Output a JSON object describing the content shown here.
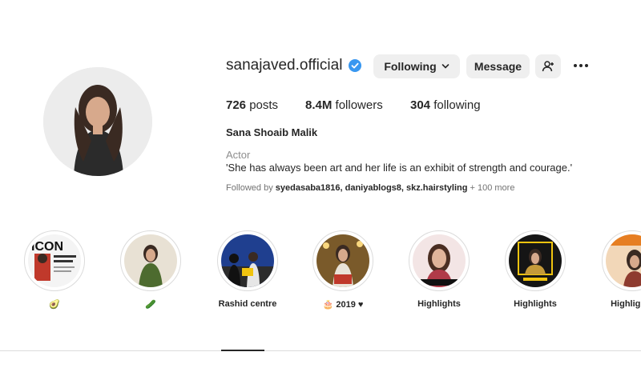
{
  "profile": {
    "username": "sanajaved.official",
    "full_name": "Sana Shoaib Malik",
    "category": "Actor",
    "bio": "'She has always been art and her life is an exhibit of strength and courage.'",
    "followed_by_prefix": "Followed by ",
    "followed_by_names": "syedasaba1816, daniyablogs8, skz.hairstyling",
    "followed_by_more": " + 100 more"
  },
  "buttons": {
    "following": "Following",
    "message": "Message"
  },
  "stats": {
    "posts_count": "726",
    "posts_label": " posts",
    "followers_count": "8.4M",
    "followers_label": " followers",
    "following_count": "304",
    "following_label": " following"
  },
  "highlights": [
    {
      "label": "🥑"
    },
    {
      "label": "🥒"
    },
    {
      "label": "Rashid centre"
    },
    {
      "label": "🎂 2019 ♥"
    },
    {
      "label": "Highlights"
    },
    {
      "label": "Highlights"
    },
    {
      "label": "Highlights"
    }
  ],
  "colors": {
    "verified_blue": "#3897f0",
    "button_bg": "#efefef",
    "text": "#262626",
    "muted": "#8e8e8e"
  }
}
